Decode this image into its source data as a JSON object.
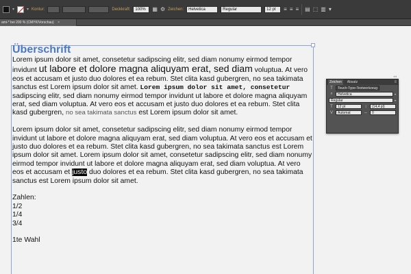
{
  "control_bar": {
    "fill_color": "#111111",
    "stroke_label": "Kontur:",
    "opacity_label": "Deckkraft:",
    "opacity_value": "100%",
    "char_label": "Zeichen:",
    "font_value": "Helvetica",
    "style_value": "Regular",
    "size_value": "12 pt"
  },
  "document_tab": {
    "title": "ami-* bei 200 % (CMYK/Vorschau)",
    "close_glyph": "×"
  },
  "text": {
    "heading": "Überschrift",
    "p1_a": "Lorem ipsum dolor sit amet, consetetur sadipscing elitr, sed diam nonumy eirmod tempor invidunt ",
    "p1_big": "ut labore et dolore magna aliquyam erat, sed diam",
    "p1_b": " voluptua. At vero eos et accusam et justo duo dolores et ea rebum. Stet clita kasd gubergren, no sea takimata sanctus est Lorem ipsum dolor sit amet. ",
    "p1_mono": "Lorem ipsum dolor sit amet, consetetur",
    "p1_c": " sadipscing elitr, sed diam nonumy eirmod tempor invidunt ut labore et dolore magna aliquyam erat, sed diam voluptua. At vero eos et accusam et justo duo dolores et ea rebum. Stet clita kasd gubergren, ",
    "p1_grey": "no sea takimata sanctus",
    "p1_d": " est Lorem ipsum dolor sit amet.",
    "p2_a": "Lorem ipsum dolor sit amet, consetetur sadipscing elitr, sed diam nonumy eirmod tempor invidunt ut labore et dolore magna aliquyam erat, sed diam voluptua. At vero eos et accusam et justo duo dolores et ea rebum. Stet clita kasd gubergren, no sea takimata sanctus est Lorem ipsum dolor sit amet. Lorem ipsum dolor sit amet, consetetur sadipscing elitr, sed diam nonumy eirmod tempor invidunt ut labore et dolore magna aliquyam erat, sed diam voluptua. At vero eos et accusam et ",
    "p2_sel": "justo",
    "p2_b": " duo dolores et ea rebum. Stet clita kasd gubergren, no sea takimata sanctus est Lorem ipsum dolor sit amet.",
    "zahlen": "Zahlen:",
    "f1": "1/2",
    "f2": "1/4",
    "f3": "3/4",
    "wahl": "1te Wahl"
  },
  "panel": {
    "tab_char": "Zeichen",
    "tab_para": "Absatz",
    "menu_glyph": "≡",
    "close_glyph": "◂◂",
    "touch_label": "Touch-Type-Textwerkzeug",
    "font": "Helvetica",
    "style": "Regular",
    "size": "12 pt",
    "leading": "(14,4 pt)",
    "kerning": "Auto",
    "tracking": "0",
    "kerning_alt": "Automat"
  }
}
